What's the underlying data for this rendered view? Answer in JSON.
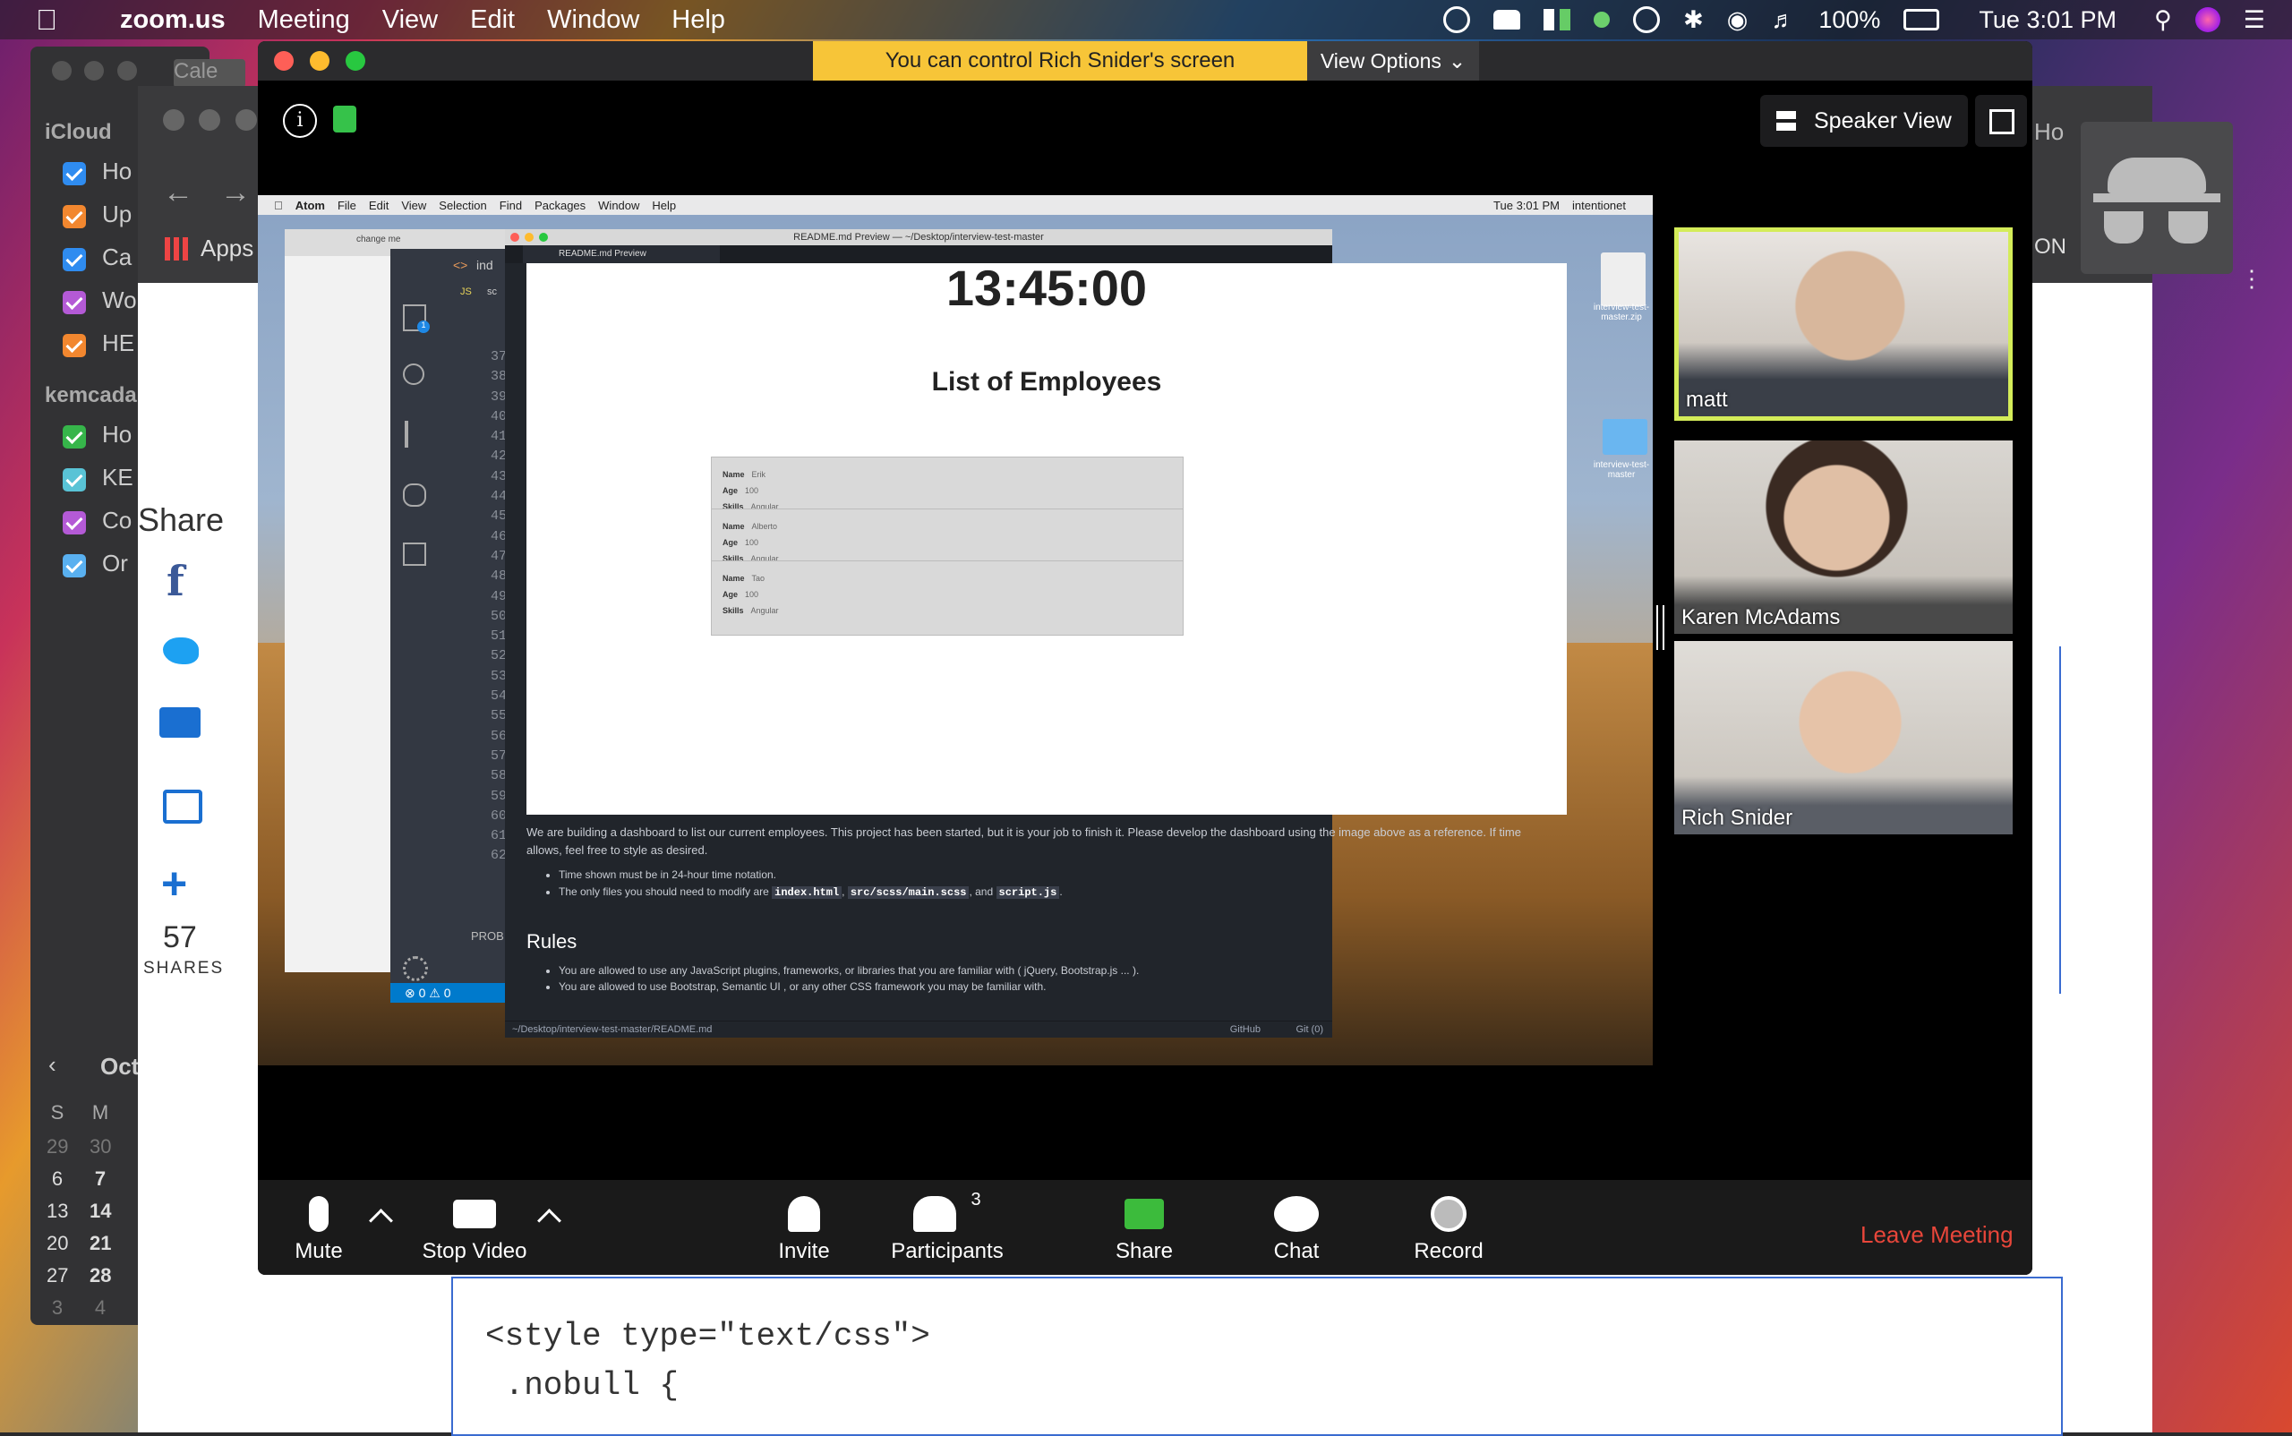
{
  "menubar": {
    "app": "zoom.us",
    "items": [
      "Meeting",
      "View",
      "Edit",
      "Window",
      "Help"
    ],
    "battery": "100%",
    "clock": "Tue 3:01 PM"
  },
  "calendar": {
    "tab_label": "Cale",
    "section1": "iCloud",
    "icloud_items": [
      {
        "label": "Ho",
        "color": "#2f8cf0"
      },
      {
        "label": "Up",
        "color": "#f2872f"
      },
      {
        "label": "Ca",
        "color": "#2f8cf0"
      },
      {
        "label": "Wo",
        "color": "#b45ad6"
      },
      {
        "label": "HE",
        "color": "#f2872f"
      }
    ],
    "section2": "kemcadan",
    "kem_items": [
      {
        "label": "Ho",
        "color": "#36b54a"
      },
      {
        "label": "KE",
        "color": "#59c3d6"
      },
      {
        "label": "Co",
        "color": "#b45ad6"
      },
      {
        "label": "Or",
        "color": "#59b0f0"
      }
    ],
    "month": "Oct",
    "weekdays": [
      "S",
      "M"
    ],
    "weeks": [
      [
        "29",
        "30"
      ],
      [
        "6",
        "7"
      ],
      [
        "13",
        "14"
      ],
      [
        "20",
        "21"
      ],
      [
        "27",
        "28"
      ],
      [
        "3",
        "4"
      ]
    ]
  },
  "browser": {
    "apps_label": "Apps",
    "right_tab": "Ho",
    "right_text": "ON",
    "code_line1": "<style type=\"text/css\">",
    "code_line2": " .nobull {"
  },
  "share_widget": {
    "title": "Share",
    "count": "57",
    "count_label": "SHARES"
  },
  "zoom": {
    "banner": "You can control Rich Snider's screen",
    "view_options": "View Options",
    "speaker_view": "Speaker View",
    "participants": [
      {
        "name": "matt",
        "active": true
      },
      {
        "name": "Karen McAdams",
        "active": false
      },
      {
        "name": "Rich Snider",
        "active": false
      }
    ],
    "toolbar": {
      "mute": "Mute",
      "stop_video": "Stop Video",
      "invite": "Invite",
      "participants": "Participants",
      "participants_count": "3",
      "share": "Share",
      "chat": "Chat",
      "record": "Record",
      "leave": "Leave Meeting"
    }
  },
  "shared_screen": {
    "menubar": [
      "Atom",
      "File",
      "Edit",
      "View",
      "Selection",
      "Find",
      "Packages",
      "Window",
      "Help"
    ],
    "menubar_right": [
      "Tue 3:01 PM",
      "intentionet"
    ],
    "window_title": "README.md Preview — ~/Desktop/interview-test-master",
    "tab_title": "README.md Preview",
    "chrome_tab": "change me",
    "editor_tab_js": "JS",
    "editor_tab": "ind",
    "editor_tab_short": "sc",
    "line_numbers": [
      "37",
      "38",
      "39",
      "40",
      "41",
      "42",
      "43",
      "44",
      "45",
      "46",
      "47",
      "48",
      "49",
      "50",
      "51",
      "52",
      "53",
      "54",
      "55",
      "56",
      "57",
      "58",
      "59",
      "60",
      "61",
      "62"
    ],
    "panel_label": "PROB",
    "status_left": "⊗ 0 ⚠ 0",
    "badge": "1",
    "clock": "13:45:00",
    "heading": "List of Employees",
    "employees": [
      {
        "name": "Erik",
        "age": "100",
        "skills": "Angular"
      },
      {
        "name": "Alberto",
        "age": "100",
        "skills": "Angular"
      },
      {
        "name": "Tao",
        "age": "100",
        "skills": "Angular"
      }
    ],
    "field_name": "Name",
    "field_age": "Age",
    "field_skills": "Skills",
    "paragraph": "We are building a dashboard to list our current employees. This project has been started, but it is your job to finish it. Please develop the dashboard using the image above as a reference. If time allows, feel free to style as desired.",
    "bullet1": "Time shown must be in 24-hour time notation.",
    "bullet2_pre": "The only files you should need to modify are",
    "bullet2_f1": "index.html",
    "bullet2_f2": "src/scss/main.scss",
    "bullet2_and": ", and",
    "bullet2_f3": "script.js",
    "rules_heading": "Rules",
    "rule1": "You are allowed to use any JavaScript plugins, frameworks, or libraries that you are familiar with ( jQuery, Bootstrap.js ... ).",
    "rule2": "You are allowed to use Bootstrap, Semantic UI , or any other CSS framework you may be familiar with.",
    "status_path": "~/Desktop/interview-test-master/README.md",
    "status_github": "GitHub",
    "status_git": "Git (0)",
    "desktop_file1": "interview-test-master.zip",
    "desktop_file2": "interview-test-master"
  }
}
